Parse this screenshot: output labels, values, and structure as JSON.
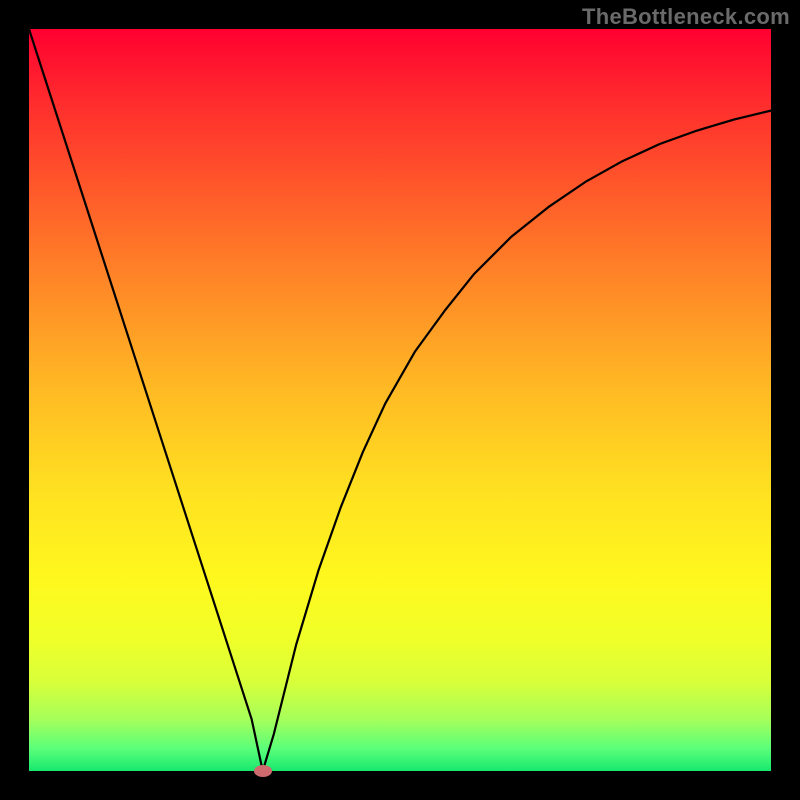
{
  "watermark": "TheBottleneck.com",
  "colors": {
    "frame": "#000000",
    "curve": "#000000",
    "marker": "#cd6b6e",
    "gradient_top": "#ff0030",
    "gradient_bottom": "#17e86f"
  },
  "chart_data": {
    "type": "line",
    "title": "",
    "xlabel": "",
    "ylabel": "",
    "xlim": [
      0,
      100
    ],
    "ylim": [
      0,
      100
    ],
    "grid": false,
    "series": [
      {
        "name": "bottleneck-curve",
        "x": [
          0,
          3,
          6,
          9,
          12,
          15,
          18,
          21,
          24,
          27,
          30,
          31.5,
          33,
          36,
          39,
          42,
          45,
          48,
          52,
          56,
          60,
          65,
          70,
          75,
          80,
          85,
          90,
          95,
          100
        ],
        "y": [
          100,
          90.7,
          81.4,
          72.1,
          62.8,
          53.5,
          44.2,
          34.9,
          25.6,
          16.3,
          7.0,
          0,
          5.0,
          17.0,
          27.0,
          35.5,
          43.0,
          49.5,
          56.5,
          62.0,
          67.0,
          72.0,
          76.0,
          79.4,
          82.2,
          84.5,
          86.3,
          87.8,
          89.0
        ]
      }
    ],
    "annotations": [
      {
        "name": "minimum-marker",
        "x": 31.5,
        "y": 0
      }
    ]
  }
}
